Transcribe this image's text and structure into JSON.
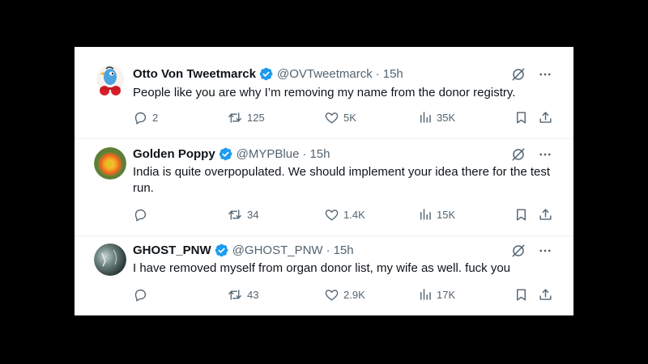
{
  "tweets": [
    {
      "name": "Otto Von Tweetmarck",
      "handle": "@OVTweetmarck",
      "sep": "·",
      "time": "15h",
      "text": "People like you are why I’m removing my name from the donor registry.",
      "replies": "2",
      "retweets": "125",
      "likes": "5K",
      "views": "35K"
    },
    {
      "name": "Golden Poppy",
      "handle": "@MYPBlue",
      "sep": "·",
      "time": "15h",
      "text": "India is quite overpopulated.  We should implement your idea there for the test run.",
      "replies": "",
      "retweets": "34",
      "likes": "1.4K",
      "views": "15K"
    },
    {
      "name": "GHOST_PNW",
      "handle": "@GHOST_PNW",
      "sep": "·",
      "time": "15h",
      "text": "I have removed myself from organ donor list, my wife as well.  fuck you",
      "replies": "",
      "retweets": "43",
      "likes": "2.9K",
      "views": "17K"
    }
  ],
  "colors": {
    "text": "#0f1419",
    "secondary": "#536471",
    "verified": "#1d9bf0",
    "divider": "#eff3f4"
  },
  "icons": [
    "verified-badge-icon",
    "grok-icon",
    "more-icon",
    "reply-icon",
    "retweet-icon",
    "like-icon",
    "views-icon",
    "bookmark-icon",
    "share-icon"
  ]
}
